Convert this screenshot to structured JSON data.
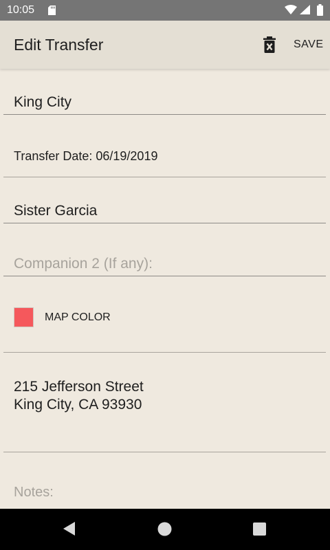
{
  "status_bar": {
    "time": "10:05",
    "icons": [
      "sd-card-icon",
      "wifi-icon",
      "signal-icon",
      "battery-icon"
    ]
  },
  "app_bar": {
    "title": "Edit Transfer",
    "delete_icon": "delete-icon",
    "save_label": "SAVE"
  },
  "form": {
    "area_value": "King City",
    "transfer_date_label": "Transfer Date: 06/19/2019",
    "companion1_value": "Sister Garcia",
    "companion2_placeholder": "Companion 2 (If any):",
    "map_color_label": "MAP COLOR",
    "map_color": "#f5585c",
    "address_line1": "215 Jefferson Street",
    "address_line2": "King City, CA 93930",
    "notes_placeholder": "Notes:"
  },
  "nav_bar": {
    "icons": [
      "back-icon",
      "home-icon",
      "recents-icon"
    ]
  }
}
